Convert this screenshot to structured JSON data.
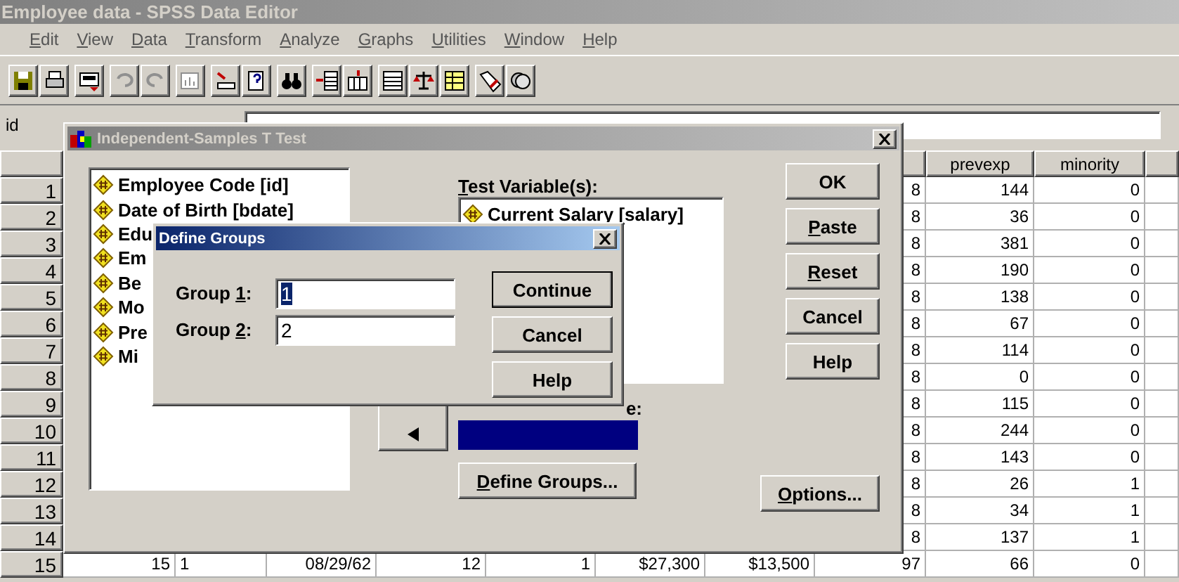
{
  "window": {
    "title": "Employee data - SPSS Data Editor",
    "active": false
  },
  "menu": [
    {
      "key": "E",
      "rest": "dit"
    },
    {
      "key": "V",
      "rest": "iew"
    },
    {
      "key": "D",
      "rest": "ata"
    },
    {
      "key": "T",
      "rest": "ransform"
    },
    {
      "key": "A",
      "rest": "nalyze"
    },
    {
      "key": "G",
      "rest": "raphs"
    },
    {
      "key": "U",
      "rest": "tilities"
    },
    {
      "key": "W",
      "rest": "indow"
    },
    {
      "key": "H",
      "rest": "elp"
    }
  ],
  "cell_editor": {
    "cell": "id"
  },
  "grid": {
    "column_headers": [
      "prevexp",
      "minority"
    ],
    "rows": [
      {
        "header": "1",
        "cells": [
          "8",
          "144",
          "0"
        ]
      },
      {
        "header": "2",
        "cells": [
          "8",
          "36",
          "0"
        ]
      },
      {
        "header": "3",
        "cells": [
          "8",
          "381",
          "0"
        ]
      },
      {
        "header": "4",
        "cells": [
          "8",
          "190",
          "0"
        ]
      },
      {
        "header": "5",
        "cells": [
          "8",
          "138",
          "0"
        ]
      },
      {
        "header": "6",
        "cells": [
          "8",
          "67",
          "0"
        ]
      },
      {
        "header": "7",
        "cells": [
          "8",
          "114",
          "0"
        ]
      },
      {
        "header": "8",
        "cells": [
          "8",
          "0",
          "0"
        ]
      },
      {
        "header": "9",
        "cells": [
          "8",
          "115",
          "0"
        ]
      },
      {
        "header": "10",
        "cells": [
          "8",
          "244",
          "0"
        ]
      },
      {
        "header": "11",
        "cells": [
          "8",
          "143",
          "0"
        ]
      },
      {
        "header": "12",
        "cells": [
          "8",
          "26",
          "1"
        ]
      },
      {
        "header": "13",
        "cells": [
          "8",
          "34",
          "1"
        ]
      },
      {
        "header": "14",
        "cells": [
          "8",
          "137",
          "1"
        ]
      },
      {
        "header": "15",
        "cells": [
          "15",
          "1",
          "08/29/62",
          "12",
          "1",
          "$27,300",
          "$13,500",
          "97",
          "66",
          "0"
        ]
      }
    ]
  },
  "ttest_dialog": {
    "title": "Independent-Samples T Test",
    "active": false,
    "variables": [
      "Employee Code [id]",
      "Date of Birth [bdate]",
      "Edu",
      "Em",
      "Be",
      "Mo",
      "Pre",
      "Mi"
    ],
    "test_label": {
      "key": "T",
      "rest": "est Variable(s):"
    },
    "test_variables": [
      "Current Salary [salary]"
    ],
    "grouping_label": "e:",
    "define_button": {
      "key": "D",
      "rest": "efine Groups..."
    },
    "buttons": [
      {
        "rest": "OK"
      },
      {
        "key": "P",
        "rest": "aste"
      },
      {
        "key": "R",
        "rest": "eset"
      },
      {
        "rest": "Cancel"
      },
      {
        "rest": "Help"
      }
    ],
    "options_button": {
      "key": "O",
      "rest": "ptions..."
    }
  },
  "define_dialog": {
    "title": "Define Groups",
    "active": true,
    "groups": [
      {
        "before": "Group ",
        "key": "1",
        "after": ":",
        "value": "1",
        "selected": true
      },
      {
        "before": "Group ",
        "key": "2",
        "after": ":",
        "value": "2",
        "selected": false
      }
    ],
    "buttons": [
      {
        "label": "Continue",
        "default": true
      },
      {
        "label": "Cancel",
        "default": false
      },
      {
        "label": "Help",
        "default": false
      }
    ]
  }
}
